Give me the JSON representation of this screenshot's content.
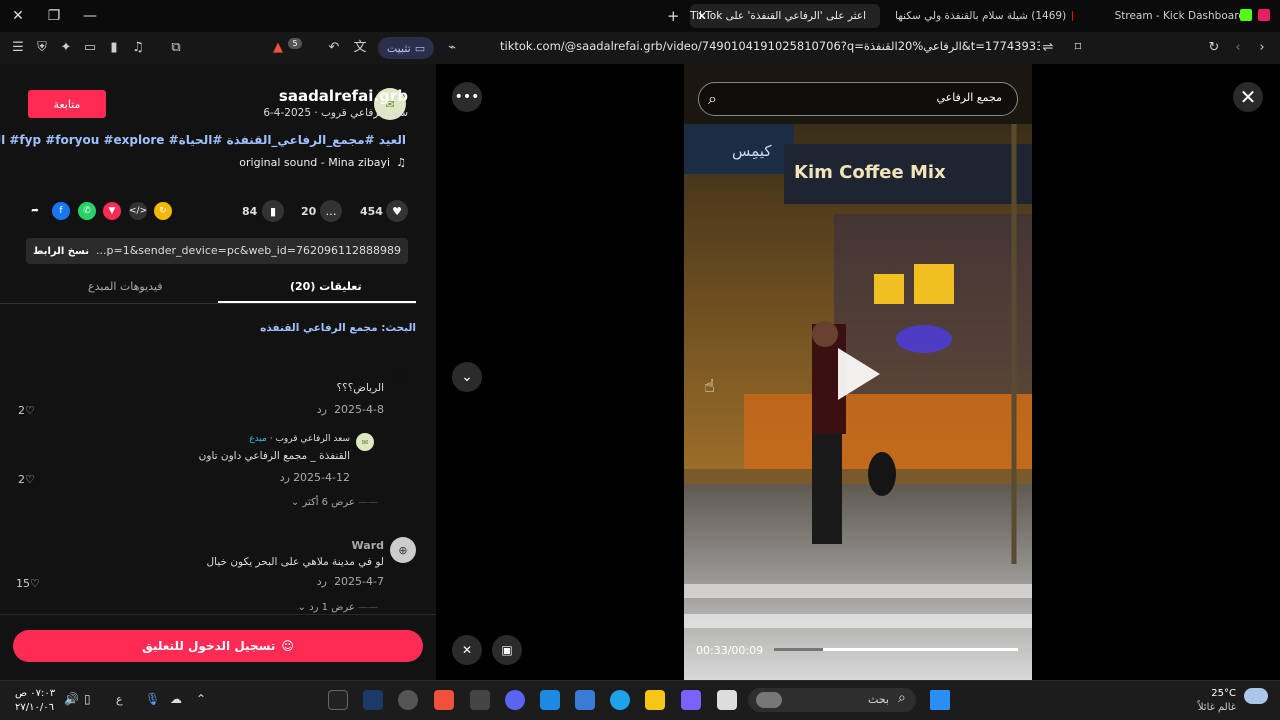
{
  "browser": {
    "tabs": [
      {
        "label": "Stream - Kick Dashboard"
      },
      {
        "label": "(1469) شيلة سلام بالقنفذة ولي سكنها"
      },
      {
        "label": "اعثر على 'الرفاعي القنفذة' على TikTok"
      }
    ],
    "url": "tiktok.com/@saadalrefai.grb/video/7490104191025810706?q=الرفاعي%20القنفذة&t=1774393307948",
    "pin_label": "تثبيت",
    "brave_badge": "5"
  },
  "post": {
    "username": "saadalrefai.grb",
    "display_line": "سعد الرفاعي قروب · 2025-4-6",
    "follow_label": "متابعة",
    "hashtags": "#القنفذة #fyp #foryou #explore #العيد #مجمع_الرفاعي_القنفذة #الحياة",
    "sound": "original sound - Mina zibayi",
    "likes": "454",
    "comments": "20",
    "saves": "84",
    "link": "...p=1&sender_device=pc&web_id=7620961128889894418",
    "copy_label": "نسخ الرابط",
    "tab_comments": "(20) تعليقات",
    "tab_creator": "فيديوهات المبدع",
    "search_hint": "البحث: مجمع الرفاعي القنفذه"
  },
  "comments": [
    {
      "text": "الرياض؟؟؟",
      "date": "2025-4-8",
      "reply": "رد",
      "likes": "2"
    },
    {
      "author": "سعد الرفاعي قروب",
      "badge": "مبدع",
      "text": "القنفذة _ مجمع الرفاعي داون تاون",
      "date": "2025-4-12",
      "reply": "رد",
      "likes": "2",
      "more": "عرض 6 أكثر"
    },
    {
      "author": "Ward",
      "text": "لو في مدينة ملاهي على البحر يكون خيال",
      "date": "2025-4-7",
      "reply": "رد",
      "likes": "15",
      "more": "عرض 1 رد"
    }
  ],
  "login_label": "تسجيل الدخول للتعليق",
  "video": {
    "search_text": "مجمع الرفاعي",
    "time": "00:33/00:09",
    "sign_left": "كيمِس",
    "sign_coffee": "Kim Coffee Mix",
    "progress": 0.8
  },
  "taskbar": {
    "weather_temp": "25°C",
    "weather_desc": "غالم غائلاً",
    "time": "٠٧:٠٣ ص",
    "date": "٢٧/١٠/٠٦",
    "lang": "ع",
    "search_label": "بحث"
  }
}
